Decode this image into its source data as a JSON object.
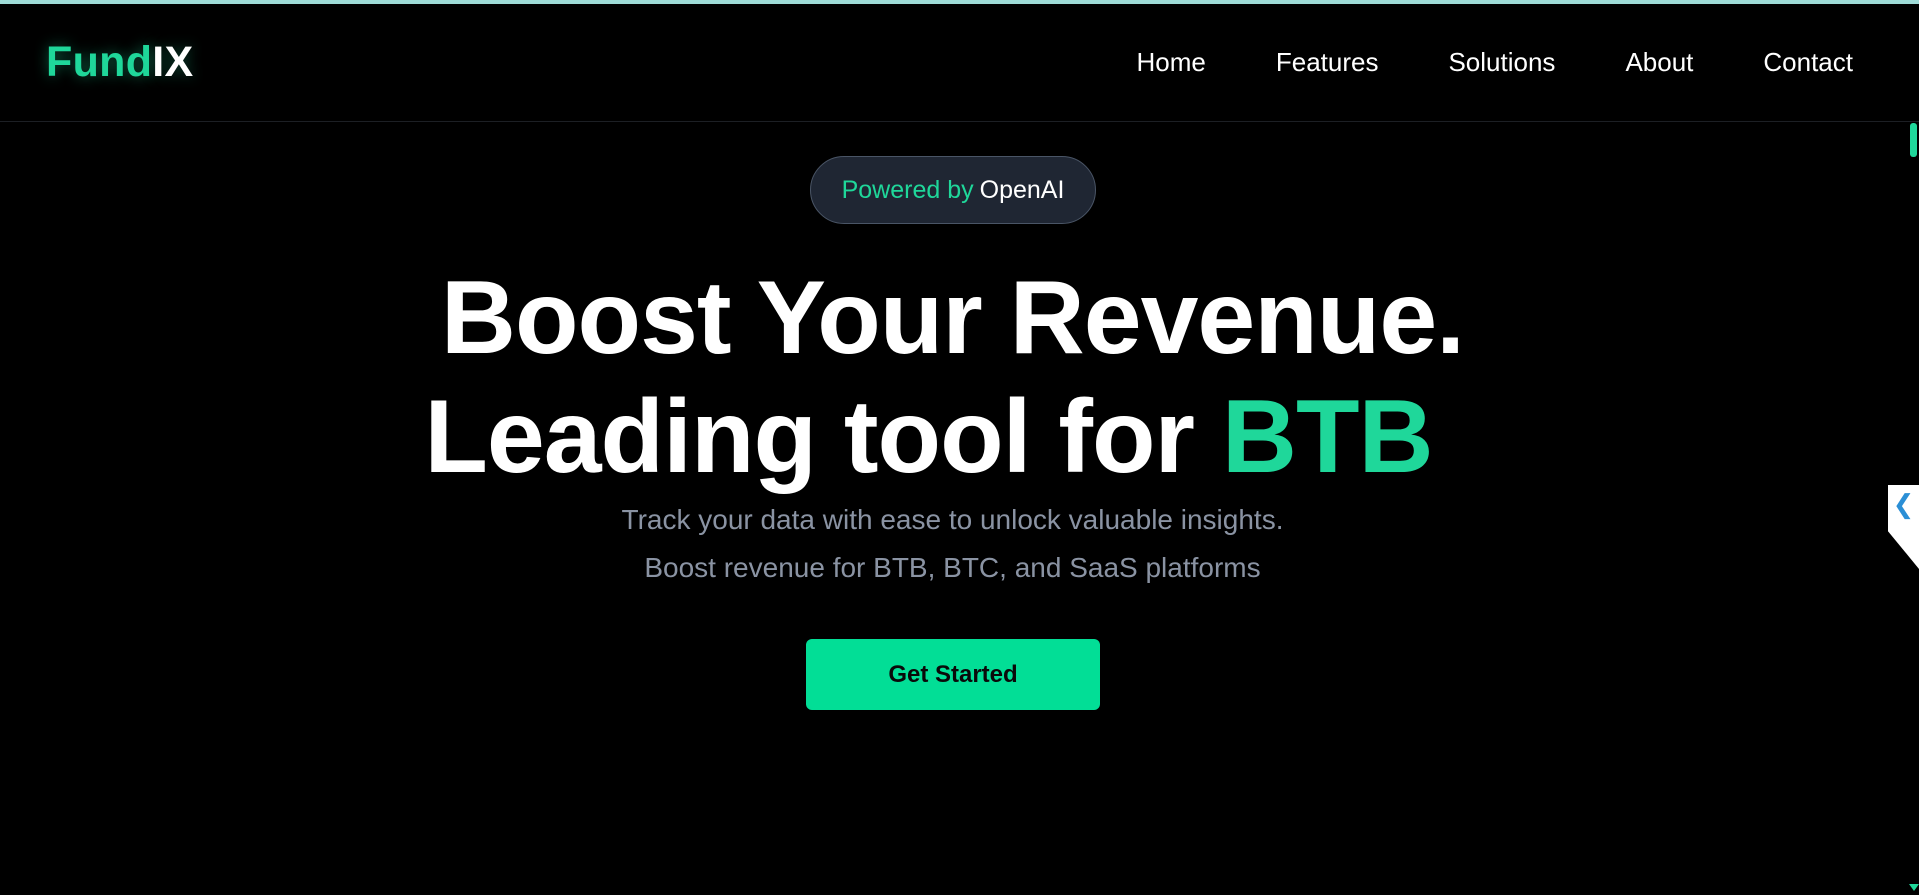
{
  "header": {
    "logo": {
      "part1": "Fund",
      "part2": "IX"
    },
    "nav": [
      {
        "label": "Home"
      },
      {
        "label": "Features"
      },
      {
        "label": "Solutions"
      },
      {
        "label": "About"
      },
      {
        "label": "Contact"
      }
    ]
  },
  "hero": {
    "badge": {
      "prefix": "Powered by",
      "brand": "OpenAI"
    },
    "headline_line1": "Boost Your Revenue.",
    "headline_line2_prefix": "Leading tool for",
    "headline_line2_accent": "BTB",
    "subtitle_line1": "Track your data with ease to unlock valuable insights.",
    "subtitle_line2": "Boost revenue for BTB, BTC, and SaaS platforms",
    "cta_label": "Get Started"
  },
  "side_tab": {
    "icon": "chevron-left-icon",
    "glyph": "❮"
  },
  "colors": {
    "background": "#000000",
    "accent": "#1fd79a",
    "cta_bg": "#02de96",
    "badge_bg": "#1f2633",
    "subtitle": "#8a93a3",
    "top_bar": "#9fdcd8"
  }
}
